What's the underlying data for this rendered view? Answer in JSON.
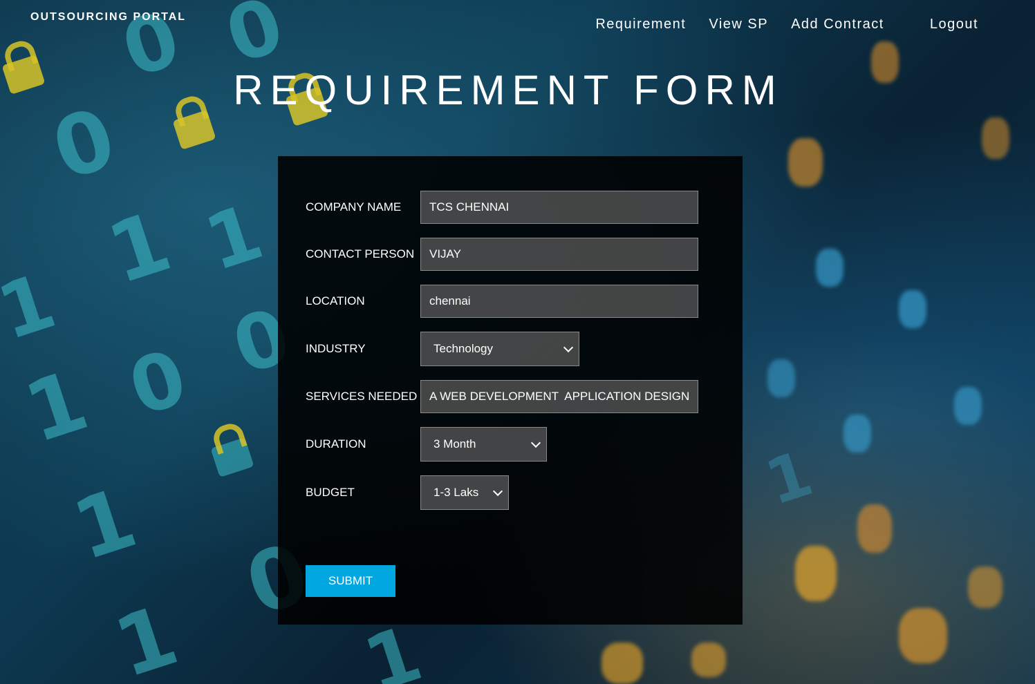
{
  "brand": "OUTSOURCING PORTAL",
  "nav": {
    "requirement": "Requirement",
    "view_sp": "View SP",
    "add_contract": "Add Contract",
    "logout": "Logout"
  },
  "page_title": "REQUIREMENT FORM",
  "form": {
    "company_name": {
      "label": "COMPANY NAME",
      "value": "TCS CHENNAI"
    },
    "contact_person": {
      "label": "CONTACT PERSON",
      "value": "VIJAY"
    },
    "location": {
      "label": "LOCATION",
      "value": "chennai"
    },
    "industry": {
      "label": "INDUSTRY",
      "selected": "Technology"
    },
    "services_needed": {
      "label": "SERVICES NEEDED",
      "value": "A WEB DEVELOPMENT  APPLICATION DESIGNIN"
    },
    "duration": {
      "label": "DURATION",
      "selected": "3 Month"
    },
    "budget": {
      "label": "BUDGET",
      "selected": "1-3 Laks"
    },
    "submit_label": "SUBMIT"
  },
  "colors": {
    "submit_button": "#00a7e1",
    "panel": "#000000",
    "text": "#ffffff"
  }
}
